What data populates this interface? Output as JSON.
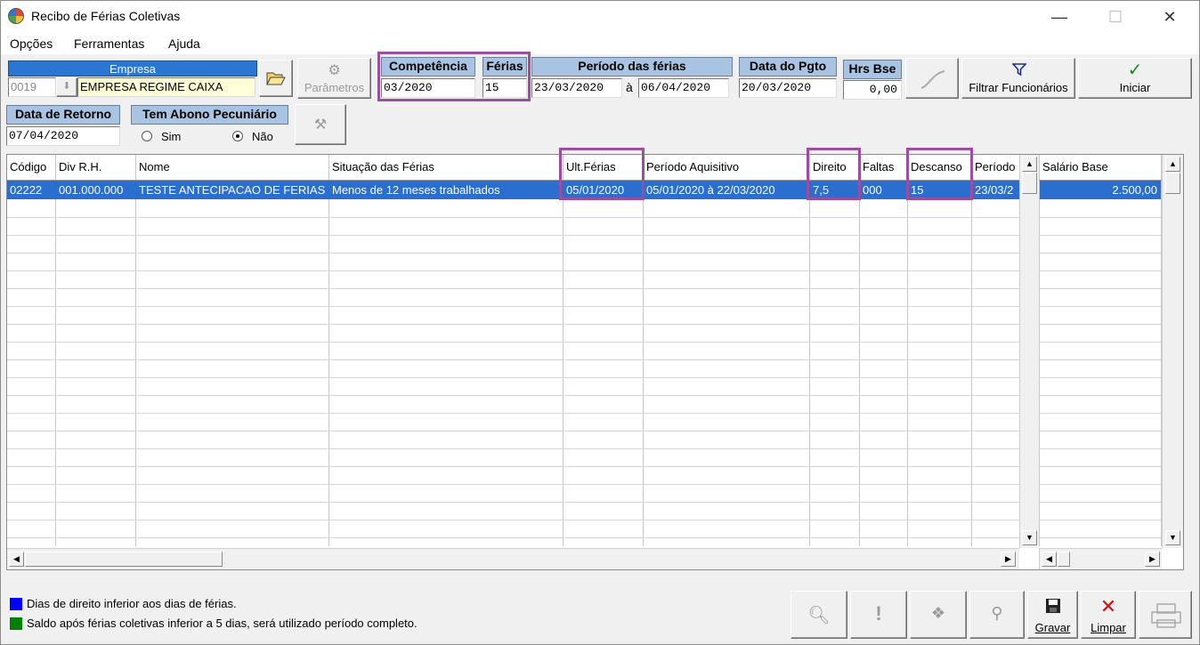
{
  "window": {
    "title": "Recibo de Férias Coletivas",
    "min": "—",
    "max": "☐",
    "close": "✕"
  },
  "menu": [
    "Opções",
    "Ferramentas",
    "Ajuda"
  ],
  "empresa": {
    "header": "Empresa",
    "code": "0019",
    "name": "EMPRESA REGIME CAIXA"
  },
  "parametros_label": "Parâmetros",
  "competencia": {
    "label": "Competência",
    "value": "03/2020"
  },
  "ferias": {
    "label": "Férias",
    "value": "15"
  },
  "periodo": {
    "label": "Período das férias",
    "start": "23/03/2020",
    "sep": "à",
    "end": "06/04/2020"
  },
  "pgto": {
    "label": "Data do Pgto",
    "value": "20/03/2020"
  },
  "hrs": {
    "label": "Hrs Bse",
    "value": "0,00"
  },
  "filtrar_label": "Filtrar Funcionários",
  "iniciar_label": "Iniciar",
  "retorno": {
    "label": "Data de Retorno",
    "value": "07/04/2020"
  },
  "abono": {
    "label": "Tem Abono Pecuniário",
    "sim": "Sim",
    "nao": "Não",
    "selected": "Não"
  },
  "grid": {
    "columns": [
      "Código",
      "Div R.H.",
      "Nome",
      "Situação das Férias",
      "Ult.Férias",
      "Período Aquisitivo",
      "Direito",
      "Faltas",
      "Descanso",
      "Período",
      "Salário Base"
    ],
    "row": [
      "02222",
      "001.000.000",
      "TESTE ANTECIPACAO DE FERIAS",
      "Menos de 12 meses trabalhados",
      "05/01/2020",
      "05/01/2020 à 22/03/2020",
      "7,5",
      "000",
      "15",
      "23/03/2",
      "2.500,00"
    ]
  },
  "legend": [
    {
      "color": "#0000ff",
      "text": "Dias de direito inferior aos dias de férias."
    },
    {
      "color": "#008000",
      "text": "Saldo após férias coletivas inferior a 5 dias, será utilizado período completo."
    }
  ],
  "bottom": {
    "gravar": "Gravar",
    "limpar": "Limpar"
  },
  "icons": [
    "app-icon",
    "folder-open-icon",
    "dropdown-arrow-icon",
    "filter-icon",
    "checkmark-icon",
    "save-icon",
    "x-icon",
    "printer-icon"
  ],
  "colors": {
    "selection": "#2a6fd0",
    "header_blue": "#2a76d2",
    "header_lightblue": "#a9c4e2",
    "highlight": "#9b4da0"
  }
}
